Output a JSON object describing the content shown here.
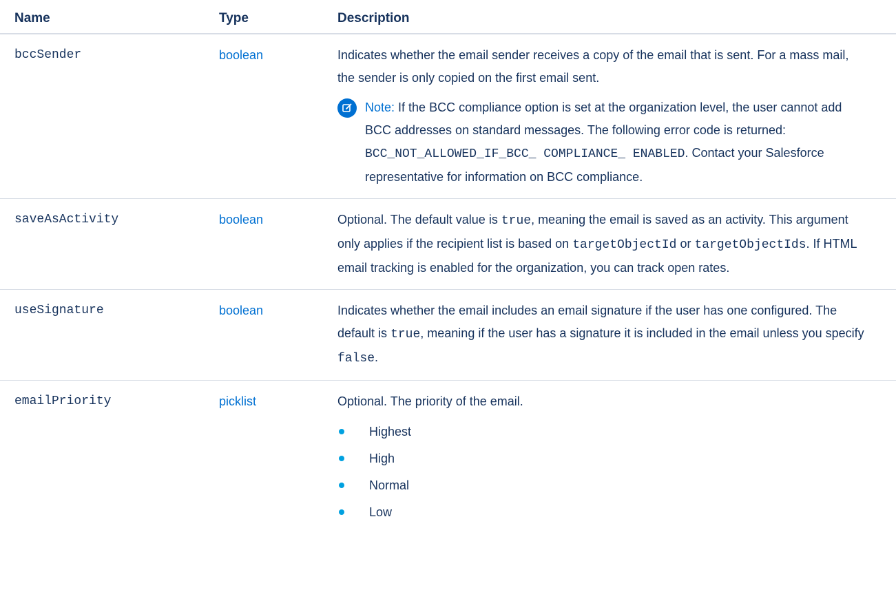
{
  "table": {
    "headers": [
      "Name",
      "Type",
      "Description"
    ],
    "rows": [
      {
        "name": "bccSender",
        "type": "boolean",
        "desc": "Indicates whether the email sender receives a copy of the email that is sent. For a mass mail, the sender is only copied on the first email sent.",
        "note": {
          "label": "Note:",
          "text_1": "If the BCC compliance option is set at the organization level, the user cannot add BCC addresses on standard messages. The following error code is returned:",
          "code": "BCC_NOT_ALLOWED_IF_BCC_ COMPLIANCE_ ENABLED",
          "text_2": ". Contact your Salesforce representative for information on BCC compliance."
        }
      },
      {
        "name": "saveAsActivity",
        "type": "boolean",
        "desc_1": "Optional. The default value is",
        "code_1": "true",
        "desc_2": ", meaning the email is saved as an activity. This argument only applies if the recipient list is based on",
        "code_2": "targetObjectId",
        "desc_3": "or",
        "code_3": "targetObjectIds",
        "desc_4": ". If HTML email tracking is enabled for the organization, you can track open rates."
      },
      {
        "name": "useSignature",
        "type": "boolean",
        "desc_1": "Indicates whether the email includes an email signature if the user has one configured. The default is",
        "code_1": "true",
        "desc_2": ", meaning if the user has a signature it is included in the email unless you specify",
        "code_2": "false",
        "desc_3": "."
      },
      {
        "name": "emailPriority",
        "type": "picklist",
        "desc": "Optional. The priority of the email.",
        "options": [
          "Highest",
          "High",
          "Normal",
          "Low"
        ]
      }
    ]
  },
  "colors": {
    "text": "#16325c",
    "link": "#0070d2",
    "bullet": "#00a1e0",
    "border": "#d8dde6"
  },
  "icons": {
    "note": "edit-note-icon"
  }
}
